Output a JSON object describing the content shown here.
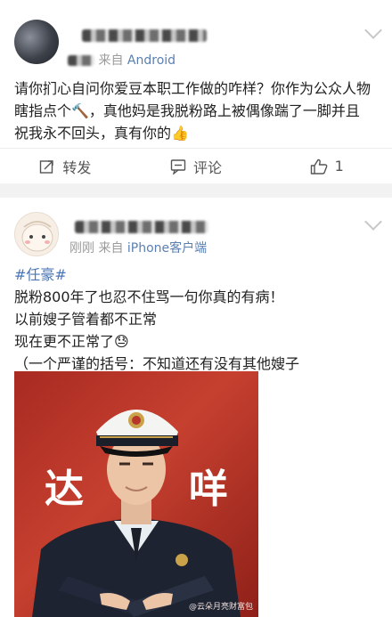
{
  "post1": {
    "meta_time": "刚刚",
    "meta_from": "来自",
    "meta_source": "Android",
    "body_lines": [
      "请你扪心自问你爱豆本职工作做的咋样？你作为公众人物",
      "瞎指点个🔨，真他妈是我脱粉路上被偶像踹了一脚并且",
      "祝我永不回头，真有你的👍"
    ],
    "actions": {
      "repost": "转发",
      "comment": "评论",
      "like_count": "1"
    }
  },
  "post2": {
    "meta_time": "刚刚",
    "meta_from": "来自",
    "meta_source": "iPhone客户端",
    "hashtag": "#任豪#",
    "body_lines": [
      "脱粉800年了也忍不住骂一句你真的有病！",
      "以前嫂子管着都不正常",
      "现在更不正常了😓",
      "（一个严谨的括号：不知道还有没有其他嫂子"
    ],
    "image_text_left": "达",
    "image_text_right": "咩",
    "image_watermark": "@云朵月亮财富包"
  },
  "colors": {
    "link_blue": "#4a76b6",
    "source_blue": "#5b7fb1",
    "meta_gray": "#9b9b9b",
    "photo_red": "#b8352a"
  },
  "icons": [
    "avatar",
    "chevron-down-icon",
    "repost-icon",
    "comment-icon",
    "like-icon"
  ]
}
